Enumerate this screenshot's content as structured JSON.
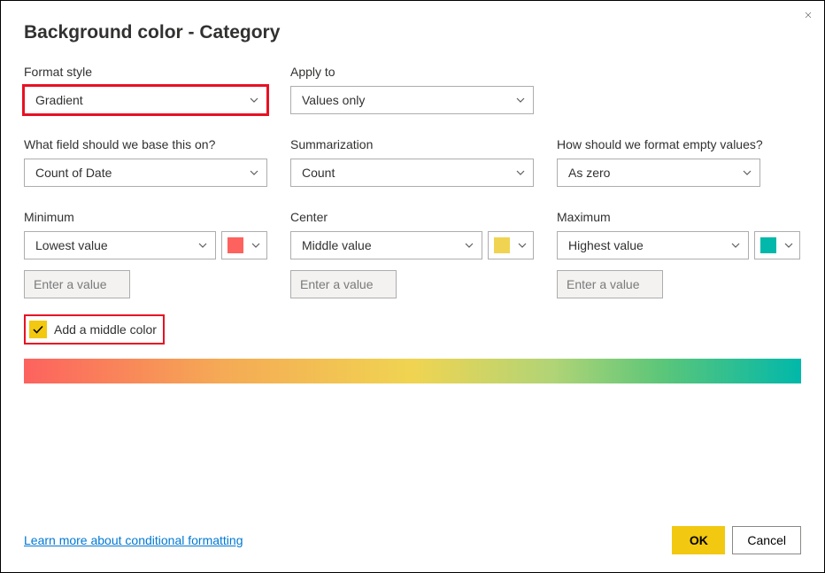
{
  "title": "Background color - Category",
  "close_icon": "×",
  "formatStyle": {
    "label": "Format style",
    "value": "Gradient"
  },
  "applyTo": {
    "label": "Apply to",
    "value": "Values only"
  },
  "baseField": {
    "label": "What field should we base this on?",
    "value": "Count of Date"
  },
  "summarization": {
    "label": "Summarization",
    "value": "Count"
  },
  "emptyValues": {
    "label": "How should we format empty values?",
    "value": "As zero"
  },
  "minimum": {
    "label": "Minimum",
    "value": "Lowest value",
    "placeholder": "Enter a value",
    "color": "#fd625e"
  },
  "center": {
    "label": "Center",
    "value": "Middle value",
    "placeholder": "Enter a value",
    "color": "#f0d451"
  },
  "maximum": {
    "label": "Maximum",
    "value": "Highest value",
    "placeholder": "Enter a value",
    "color": "#01b8aa"
  },
  "addMiddle": {
    "label": "Add a middle color",
    "checked": true
  },
  "link": "Learn more about conditional formatting",
  "ok": "OK",
  "cancel": "Cancel"
}
